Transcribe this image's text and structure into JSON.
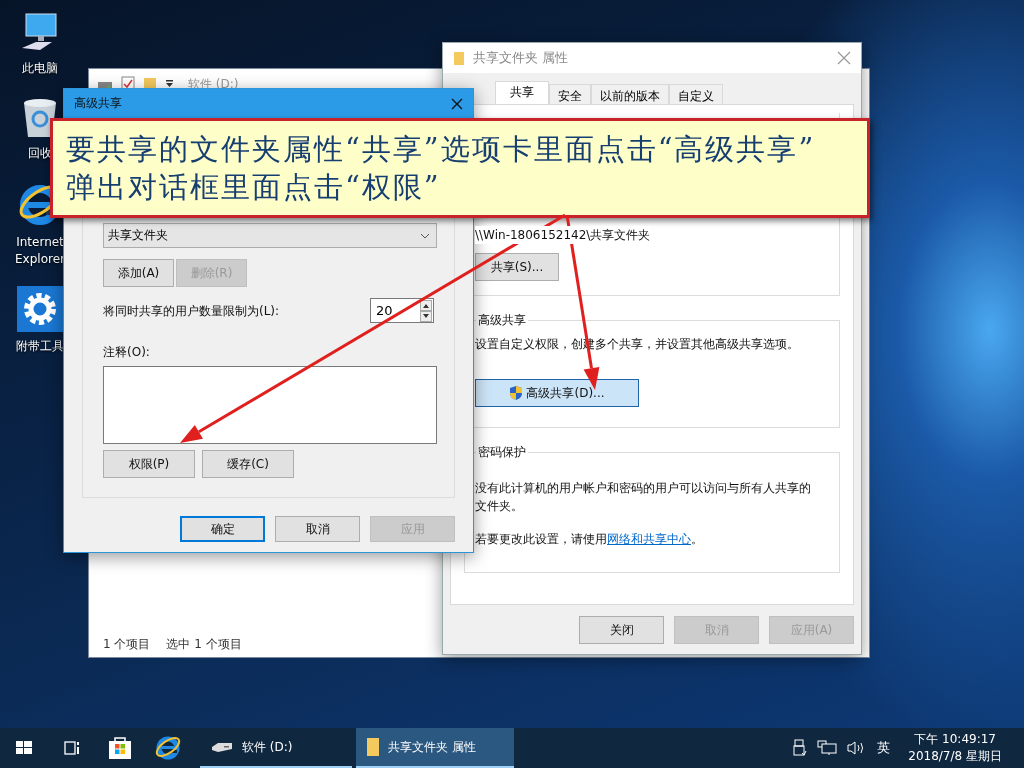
{
  "desktop_icons": [
    {
      "label": "此电脑",
      "kind": "computer"
    },
    {
      "label": "回收",
      "kind": "recycle"
    },
    {
      "label": "Internet Explorer",
      "kind": "ie"
    },
    {
      "label": "附带工具",
      "kind": "tools"
    }
  ],
  "explorer_window": {
    "title": "软件 (D:)",
    "status": [
      "1 个项目",
      "选中 1 个项目"
    ]
  },
  "properties_window": {
    "title": "共享文件夹 属性",
    "tabs": [
      {
        "label": "共享",
        "selected": true
      },
      {
        "label": "安全",
        "selected": false
      },
      {
        "label": "以前的版本",
        "selected": false
      },
      {
        "label": "自定义",
        "selected": false
      }
    ],
    "network_path": "\\\\Win-1806152142\\共享文件夹",
    "share_button": "共享(S)...",
    "advanced_group": {
      "title": "高级共享",
      "description": "设置自定义权限，创建多个共享，并设置其他高级共享选项。",
      "button": "高级共享(D)...",
      "hover": true
    },
    "password_group": {
      "title": "密码保护",
      "description": "没有此计算机的用户帐户和密码的用户可以访问与所有人共享的文件夹。",
      "hint_before": "若要更改此设置，请使用",
      "link": "网络和共享中心",
      "hint_after": "。"
    },
    "buttons": [
      {
        "label": "关闭",
        "disabled": false
      },
      {
        "label": "取消",
        "disabled": true
      },
      {
        "label": "应用(A)",
        "disabled": true
      }
    ]
  },
  "advanced_sharing_dialog": {
    "title": "高级共享",
    "share_name": "共享文件夹",
    "share_buttons": [
      {
        "label": "添加(A)",
        "disabled": false
      },
      {
        "label": "删除(R)",
        "disabled": true
      }
    ],
    "user_limit_label": "将同时共享的用户数量限制为(L):",
    "user_limit": "20",
    "comments_label": "注释(O):",
    "option_buttons": [
      {
        "label": "权限(P)",
        "disabled": false
      },
      {
        "label": "缓存(C)",
        "disabled": false
      }
    ],
    "buttons": [
      {
        "label": "确定",
        "default": true,
        "disabled": false
      },
      {
        "label": "取消",
        "default": false,
        "disabled": false
      },
      {
        "label": "应用",
        "default": false,
        "disabled": true
      }
    ]
  },
  "callout": {
    "lines": [
      "要共享的文件夹属性“共享”选项卡里面点击“高级共享”",
      "弹出对话框里面点击“权限”"
    ]
  },
  "taskbar": {
    "apps": [
      {
        "label": "软件 (D:)",
        "kind": "drive",
        "active": false
      },
      {
        "label": "共享文件夹 属性",
        "kind": "folder",
        "active": true
      }
    ],
    "input_indicator": "英",
    "time": "下午 10:49:17",
    "date": "2018/7/8 星期日"
  }
}
